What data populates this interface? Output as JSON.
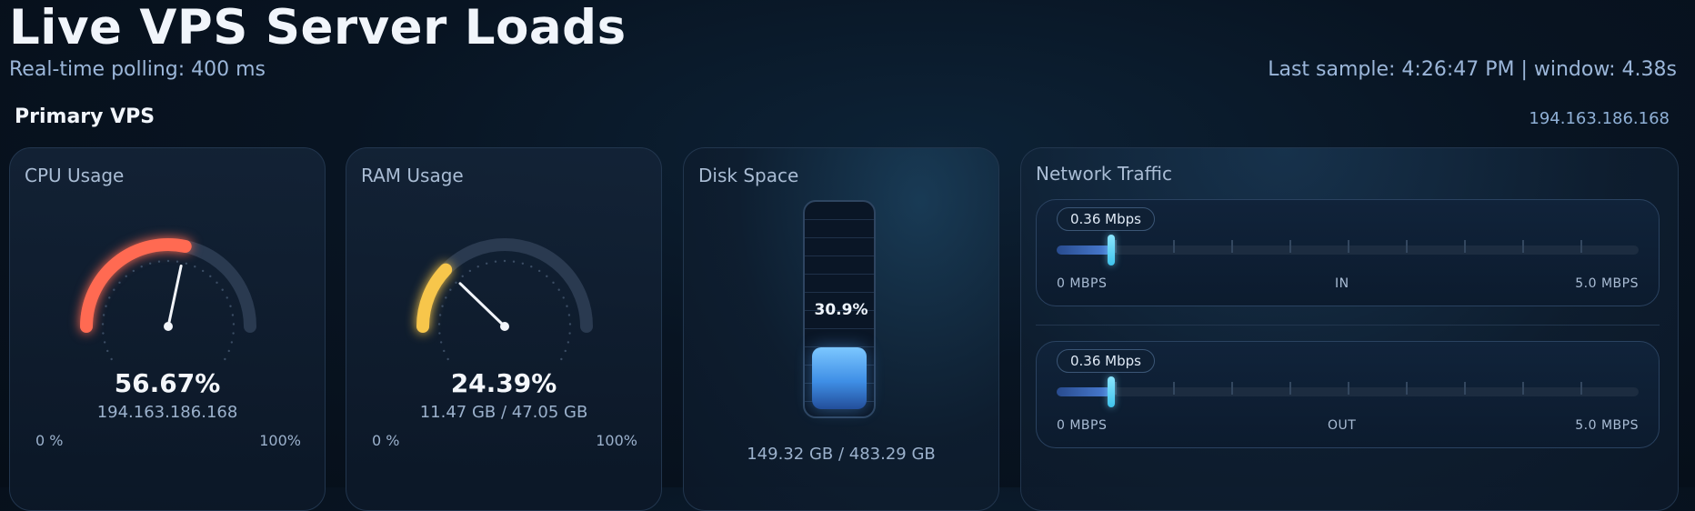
{
  "header": {
    "title": "Live VPS Server Loads",
    "subtitle": "Real-time polling: 400 ms",
    "last_sample": "Last sample: 4:26:47 PM | window: 4.38s"
  },
  "section": {
    "title": "Primary VPS",
    "ip": "194.163.186.168"
  },
  "cpu": {
    "title": "CPU Usage",
    "value_text": "56.67%",
    "value_fraction": 0.5667,
    "subtext": "194.163.186.168",
    "min_label": "0 %",
    "max_label": "100%",
    "color": "#ff6a52"
  },
  "ram": {
    "title": "RAM Usage",
    "value_text": "24.39%",
    "value_fraction": 0.2439,
    "subtext": "11.47 GB / 47.05 GB",
    "min_label": "0 %",
    "max_label": "100%",
    "color": "#f7c64b"
  },
  "disk": {
    "title": "Disk Space",
    "value_text": "30.9%",
    "value_fraction": 0.309,
    "subtext": "149.32 GB / 483.29 GB"
  },
  "network": {
    "title": "Network Traffic",
    "in": {
      "value_text": "0.36 Mbps",
      "value_mbps": 0.36,
      "min_label": "0 MBPS",
      "label": "IN",
      "max_label": "5.0 MBPS"
    },
    "out": {
      "value_text": "0.36 Mbps",
      "value_mbps": 0.36,
      "min_label": "0 MBPS",
      "label": "OUT",
      "max_label": "5.0 MBPS"
    }
  }
}
